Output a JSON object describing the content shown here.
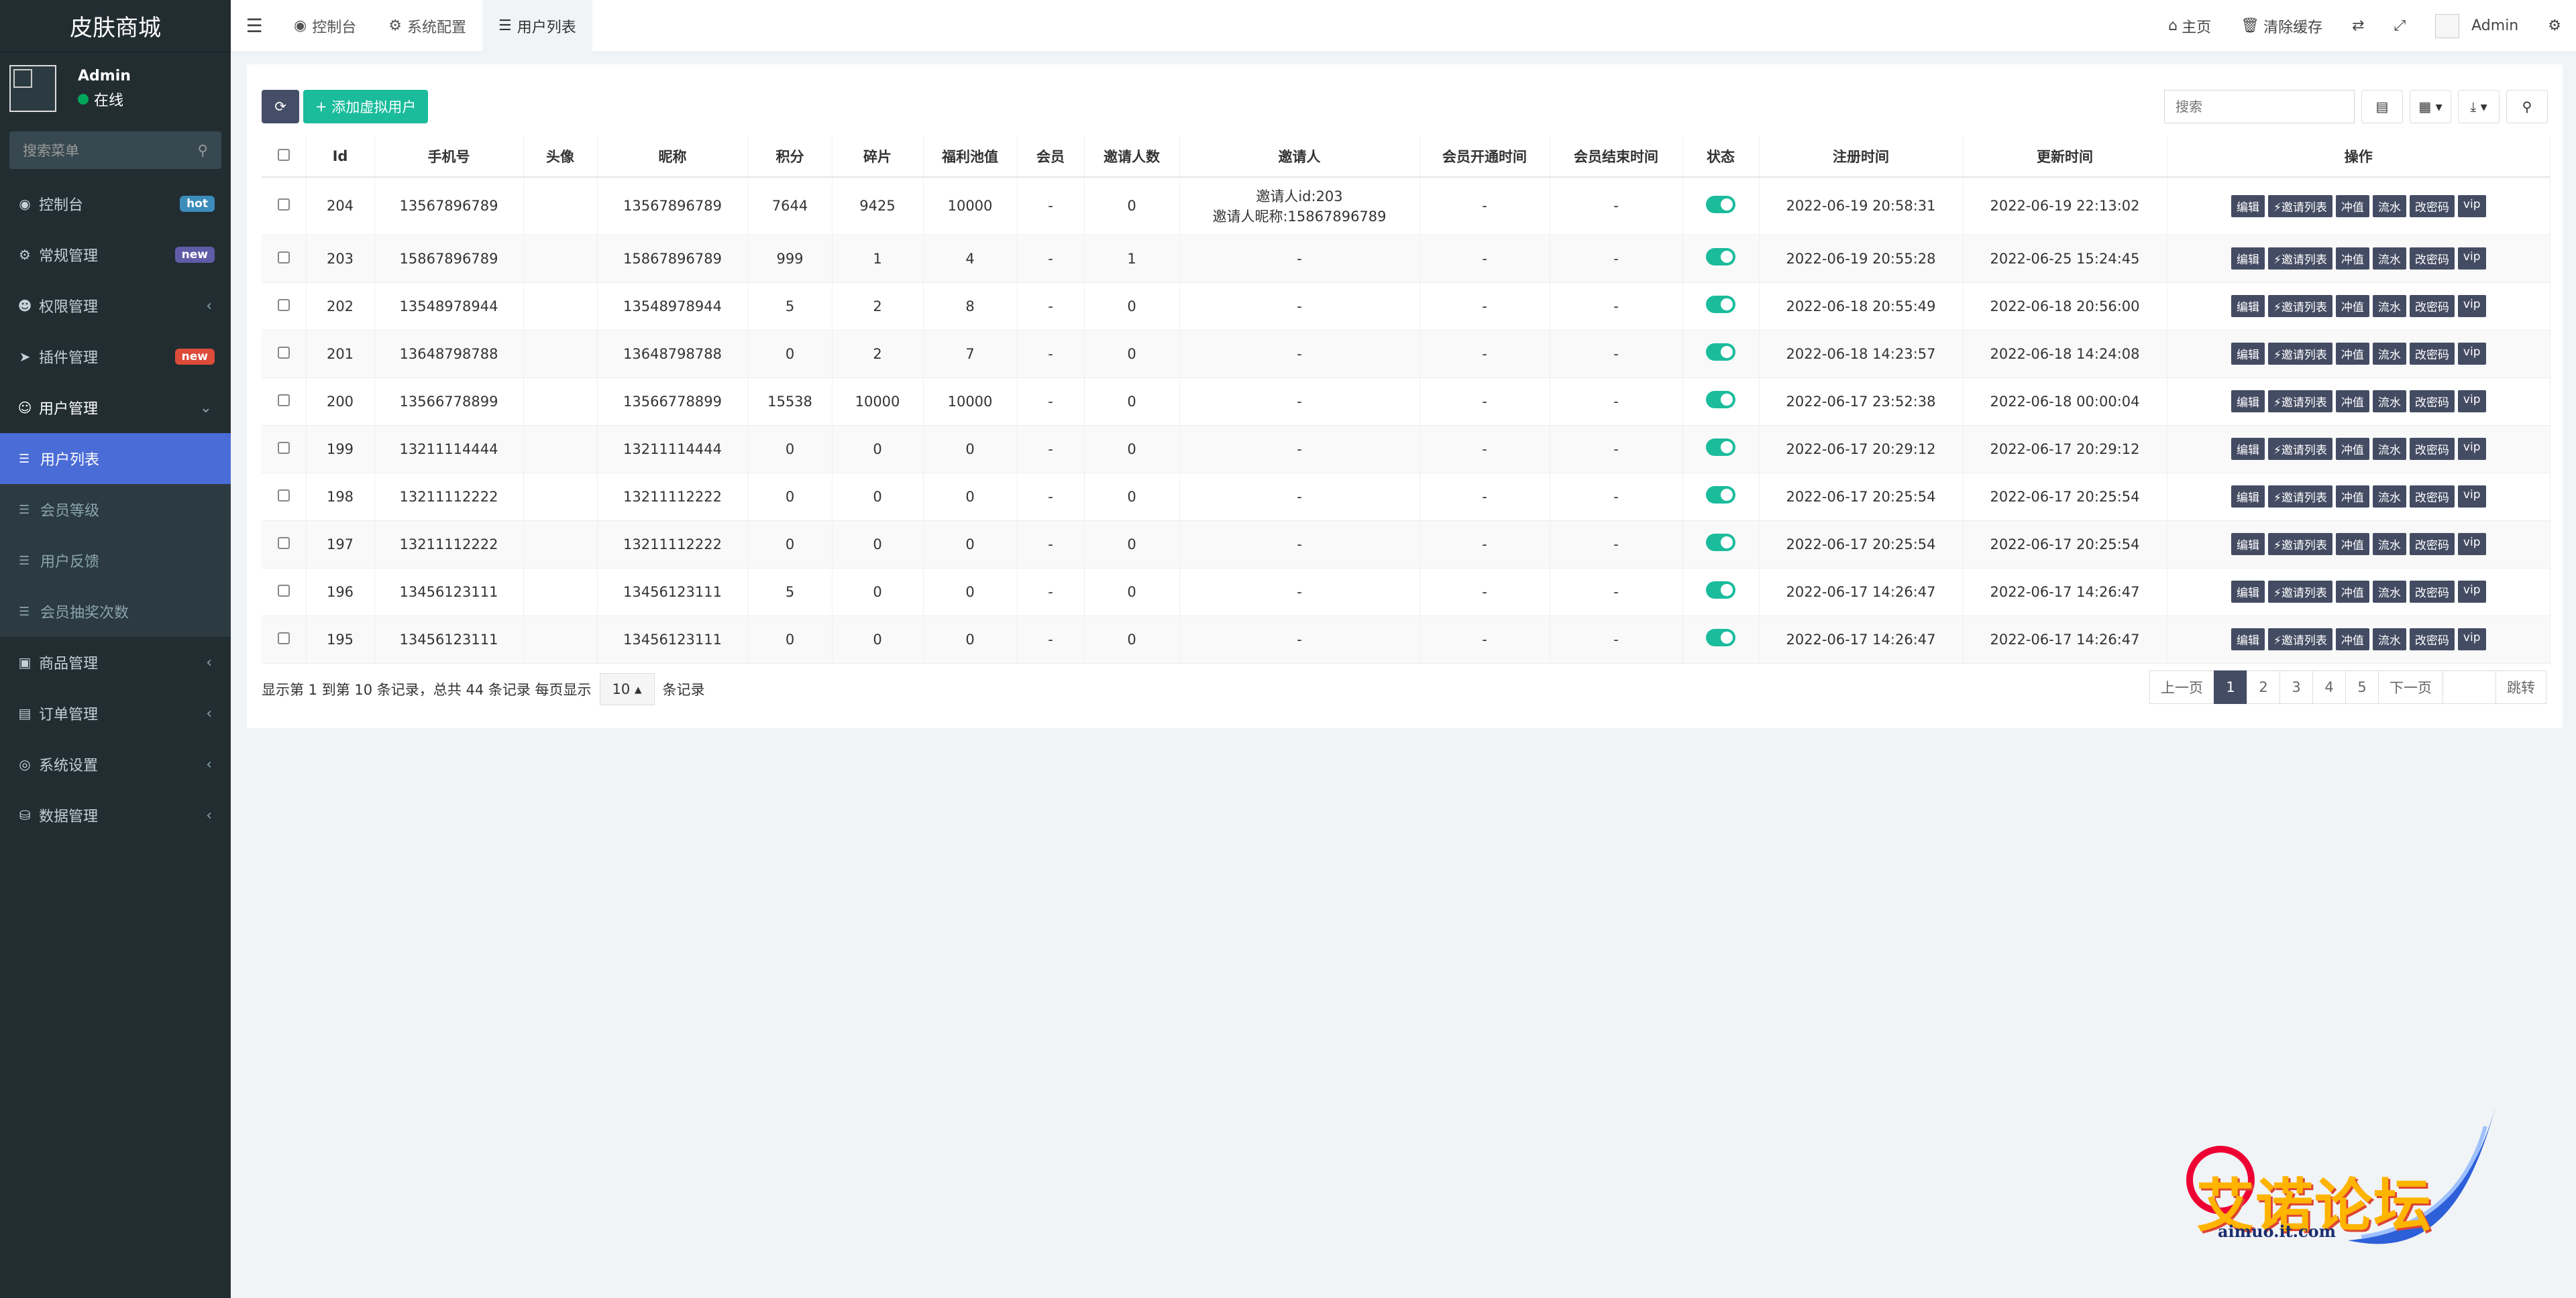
{
  "sidebar": {
    "logo": "皮肤商城",
    "user": {
      "name": "Admin",
      "status": "在线"
    },
    "search_placeholder": "搜索菜单",
    "menu": [
      {
        "label": "控制台",
        "icon": "dashboard-icon",
        "badge": "hot",
        "badge_color": "#3c8dbc"
      },
      {
        "label": "常规管理",
        "icon": "cogs-icon",
        "badge": "new",
        "badge_color": "#605ca8"
      },
      {
        "label": "权限管理",
        "icon": "group-icon"
      },
      {
        "label": "插件管理",
        "icon": "rocket-icon",
        "badge": "new",
        "badge_color": "#dd4b39"
      },
      {
        "label": "用户管理",
        "icon": "user-circle-icon"
      }
    ],
    "submenu": [
      "用户列表",
      "会员等级",
      "用户反馈",
      "会员抽奖次数"
    ],
    "menu_after": [
      {
        "label": "商品管理",
        "icon": "store-icon"
      },
      {
        "label": "订单管理",
        "icon": "order-icon"
      },
      {
        "label": "系统设置",
        "icon": "settings-icon"
      },
      {
        "label": "数据管理",
        "icon": "database-icon"
      }
    ]
  },
  "topbar": {
    "tabs": [
      "控制台",
      "系统配置",
      "用户列表"
    ],
    "right": {
      "home": "主页",
      "clear_cache": "清除缓存",
      "admin": "Admin"
    }
  },
  "toolbar": {
    "add_label": "添加虚拟用户",
    "search_placeholder": "搜索"
  },
  "table": {
    "columns": [
      "Id",
      "手机号",
      "头像",
      "昵称",
      "积分",
      "碎片",
      "福利池值",
      "会员",
      "邀请人数",
      "邀请人",
      "会员开通时间",
      "会员结束时间",
      "状态",
      "注册时间",
      "更新时间",
      "操作"
    ],
    "rows": [
      {
        "id": "204",
        "phone": "13567896789",
        "avatar": "",
        "nick": "13567896789",
        "points": "7644",
        "frag": "9425",
        "pool": "10000",
        "vip": "-",
        "invites": "0",
        "inviter1": "邀请人id:203",
        "inviter2": "邀请人昵称:15867896789",
        "vip_start": "-",
        "vip_end": "-",
        "reg": "2022-06-19 20:58:31",
        "upd": "2022-06-19 22:13:02"
      },
      {
        "id": "203",
        "phone": "15867896789",
        "avatar": "",
        "nick": "15867896789",
        "points": "999",
        "frag": "1",
        "pool": "4",
        "vip": "-",
        "invites": "1",
        "inviter1": "-",
        "inviter2": "",
        "vip_start": "-",
        "vip_end": "-",
        "reg": "2022-06-19 20:55:28",
        "upd": "2022-06-25 15:24:45"
      },
      {
        "id": "202",
        "phone": "13548978944",
        "avatar": "",
        "nick": "13548978944",
        "points": "5",
        "frag": "2",
        "pool": "8",
        "vip": "-",
        "invites": "0",
        "inviter1": "-",
        "inviter2": "",
        "vip_start": "-",
        "vip_end": "-",
        "reg": "2022-06-18 20:55:49",
        "upd": "2022-06-18 20:56:00"
      },
      {
        "id": "201",
        "phone": "13648798788",
        "avatar": "",
        "nick": "13648798788",
        "points": "0",
        "frag": "2",
        "pool": "7",
        "vip": "-",
        "invites": "0",
        "inviter1": "-",
        "inviter2": "",
        "vip_start": "-",
        "vip_end": "-",
        "reg": "2022-06-18 14:23:57",
        "upd": "2022-06-18 14:24:08"
      },
      {
        "id": "200",
        "phone": "13566778899",
        "avatar": "",
        "nick": "13566778899",
        "points": "15538",
        "frag": "10000",
        "pool": "10000",
        "vip": "-",
        "invites": "0",
        "inviter1": "-",
        "inviter2": "",
        "vip_start": "-",
        "vip_end": "-",
        "reg": "2022-06-17 23:52:38",
        "upd": "2022-06-18 00:00:04"
      },
      {
        "id": "199",
        "phone": "13211114444",
        "avatar": "",
        "nick": "13211114444",
        "points": "0",
        "frag": "0",
        "pool": "0",
        "vip": "-",
        "invites": "0",
        "inviter1": "-",
        "inviter2": "",
        "vip_start": "-",
        "vip_end": "-",
        "reg": "2022-06-17 20:29:12",
        "upd": "2022-06-17 20:29:12"
      },
      {
        "id": "198",
        "phone": "13211112222",
        "avatar": "",
        "nick": "13211112222",
        "points": "0",
        "frag": "0",
        "pool": "0",
        "vip": "-",
        "invites": "0",
        "inviter1": "-",
        "inviter2": "",
        "vip_start": "-",
        "vip_end": "-",
        "reg": "2022-06-17 20:25:54",
        "upd": "2022-06-17 20:25:54"
      },
      {
        "id": "197",
        "phone": "13211112222",
        "avatar": "",
        "nick": "13211112222",
        "points": "0",
        "frag": "0",
        "pool": "0",
        "vip": "-",
        "invites": "0",
        "inviter1": "-",
        "inviter2": "",
        "vip_start": "-",
        "vip_end": "-",
        "reg": "2022-06-17 20:25:54",
        "upd": "2022-06-17 20:25:54"
      },
      {
        "id": "196",
        "phone": "13456123111",
        "avatar": "",
        "nick": "13456123111",
        "points": "5",
        "frag": "0",
        "pool": "0",
        "vip": "-",
        "invites": "0",
        "inviter1": "-",
        "inviter2": "",
        "vip_start": "-",
        "vip_end": "-",
        "reg": "2022-06-17 14:26:47",
        "upd": "2022-06-17 14:26:47"
      },
      {
        "id": "195",
        "phone": "13456123111",
        "avatar": "",
        "nick": "13456123111",
        "points": "0",
        "frag": "0",
        "pool": "0",
        "vip": "-",
        "invites": "0",
        "inviter1": "-",
        "inviter2": "",
        "vip_start": "-",
        "vip_end": "-",
        "reg": "2022-06-17 14:26:47",
        "upd": "2022-06-17 14:26:47"
      }
    ],
    "actions": [
      "编辑",
      "邀请列表",
      "冲值",
      "流水",
      "改密码",
      "vip"
    ]
  },
  "footer": {
    "info": "显示第 1 到第 10 条记录，总共 44 条记录 每页显示",
    "page_size": "10",
    "suffix": "条记录",
    "prev": "上一页",
    "pages": [
      "1",
      "2",
      "3",
      "4",
      "5"
    ],
    "next": "下一页",
    "jump": "跳转"
  },
  "watermark": {
    "text": "艾诺论坛",
    "url": "aimuo.it.com"
  },
  "colors": {
    "sidebar_bg": "#222d32",
    "accent": "#1abc9c",
    "dark_btn": "#444c63",
    "active_menu": "#4a6cd6"
  }
}
